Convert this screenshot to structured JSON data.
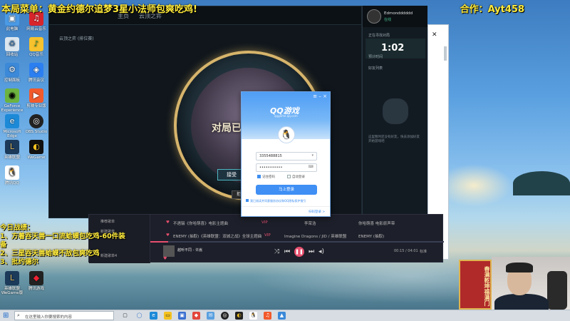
{
  "overlay": {
    "top_left": "本局菜单：黄金约德尔追梦3星小法师包爽吃鸡!",
    "top_right": "合作：Ayt458",
    "left_lines": [
      "今日战绩：",
      "1、方着吞天兽一口流蛤蟆包吃鸡-60件装备",
      "2、三星吞天兽蛤蟆不敌包爽吃鸡",
      "3、批约德尔"
    ]
  },
  "game_window": {
    "tab_home": "主页",
    "tab_mode": "云顶之弈",
    "subtitle": "云顶之弈 (排位赛)",
    "center_title": "对局已",
    "accept_button": "接受",
    "decline_button": "拒"
  },
  "side_panel": {
    "user_name": "Edmondddddd",
    "user_status": "在线",
    "queue_label": "正在寻找对局",
    "timer": "1:02",
    "timer_sub": "预计时间",
    "friends_label": "好友列表",
    "note": "这里暂时还没有好友，快去添加好友开始游戏吧"
  },
  "music_player": {
    "left_items": [
      "推荐歌单",
      "新建歌单",
      "新建歌单4"
    ],
    "rows": [
      {
        "title": "不遇辍《你哈萌喜》电影主题曲",
        "tag": "VIP",
        "artist": "李荣浩",
        "album": "你哈萌喜 电影原声带"
      },
      {
        "title": "ENEMY (抽取)《英雄联盟：双城之战》全球主题曲",
        "tag": "VIP",
        "artist": "Imagine Dragons / JID / 英雄联盟",
        "album": "ENEMY (抽取)"
      }
    ],
    "current_track": "越听不同 - 许嵩",
    "time": "00:15 / 04:01",
    "quality": "标准",
    "progress_fraction": 0.06
  },
  "qq_dialog": {
    "logo": "QQ游戏",
    "logo_sub": "qqgame.qq.com",
    "account": "3355488815",
    "password_mask": "•••••••••••",
    "remember_password": "记住密码",
    "auto_login": "自动登录",
    "login_button": "马上登录",
    "agreement": "我已阅读并同意服务协议和QQ隐私保护指引",
    "scan_login": "扫码登录 >"
  },
  "desktop_icons": [
    "此电脑",
    "网易云音乐",
    "回收站",
    "QQ音乐",
    "控制面板",
    "腾讯会议",
    "GeForce Experience",
    "剪映专业版",
    "Microsoft Edge",
    "OBS Studio",
    "英雄联盟",
    "WeGame",
    "腾讯QQ",
    "英雄联盟WeGame版",
    "腾讯游戏"
  ],
  "couplet_text": "春满乾坤福满门",
  "taskbar": {
    "search_placeholder": "在这里输入你要搜索的内容"
  },
  "colors": {
    "overlay_yellow": "#ffeb3b",
    "qq_blue": "#3f8ff4",
    "music_accent": "#e84f6e"
  }
}
